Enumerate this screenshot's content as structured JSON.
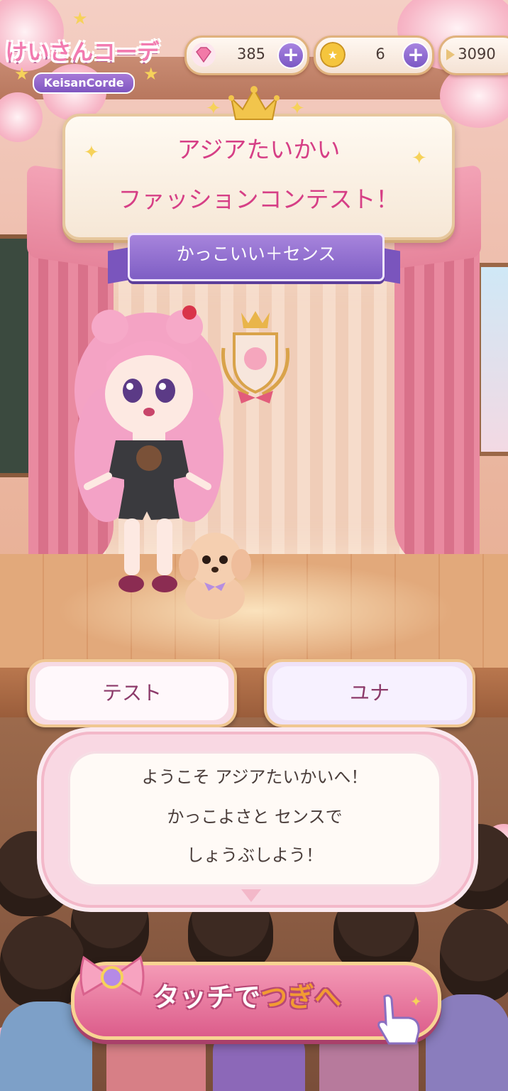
{
  "hud": {
    "logo_title": "けいさんコーデ",
    "logo_subtitle": "KeisanCorde",
    "currencies": [
      {
        "name": "gem",
        "value": "385",
        "icon": "pink-gem-icon"
      },
      {
        "name": "coin",
        "value": "6",
        "icon": "gold-coin-icon"
      },
      {
        "name": "third",
        "value": "3090",
        "icon": "ribbon-icon"
      }
    ],
    "plus_label": "+"
  },
  "contest": {
    "title_line1": "アジアたいかい",
    "title_line2": "ファッションコンテスト！",
    "theme": "かっこいい＋センス"
  },
  "players": {
    "left_name": "テスト",
    "right_name": "ユナ"
  },
  "dialog": {
    "line1": "ようこそ アジアたいかいへ！",
    "line2": "かっこよさと センスで",
    "line3": "しょうぶしよう！"
  },
  "next_button": {
    "label_part1": "タッチで",
    "label_part2": "つぎへ"
  },
  "colors": {
    "title_pink": "#d63f86",
    "theme_purple": "#7e5ec4",
    "accent_pink": "#dc5d8b",
    "accent_yellow": "#f29b33"
  }
}
